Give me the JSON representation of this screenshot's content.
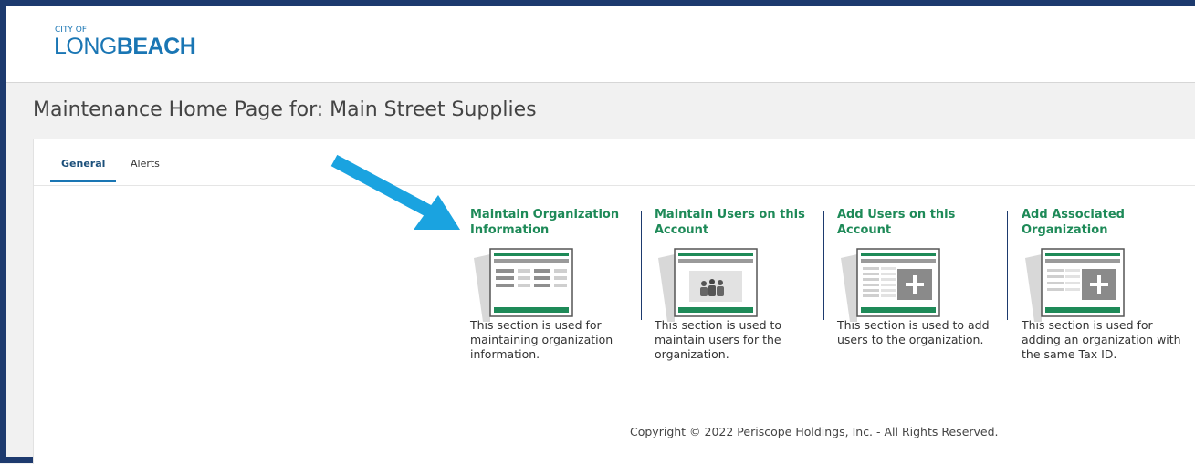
{
  "header": {
    "logo_cityof": "CITY OF",
    "logo_long": "LONG",
    "logo_beach": "BEACH"
  },
  "page": {
    "title": "Maintenance Home Page for: Main Street Supplies"
  },
  "tabs": [
    {
      "label": "General",
      "active": true
    },
    {
      "label": "Alerts",
      "active": false
    }
  ],
  "cards": [
    {
      "title": "Maintain Organization Information",
      "description": "This section is used for maintaining organization information.",
      "icon": "document-list-icon"
    },
    {
      "title": "Maintain Users on this Account",
      "description": "This section is used to maintain users for the organization.",
      "icon": "users-document-icon"
    },
    {
      "title": "Add Users on this Account",
      "description": "This section is used to add users to the organization.",
      "icon": "add-document-icon"
    },
    {
      "title": "Add Associated Organization",
      "description": "This section is used for adding an organization with the same Tax ID.",
      "icon": "add-document-icon"
    }
  ],
  "footer": {
    "copyright": "Copyright © 2022 Periscope Holdings, Inc. - All Rights Reserved."
  },
  "colors": {
    "accent_green": "#1e8a58",
    "logo_blue": "#1a76b4",
    "frame_navy": "#1d3a6e",
    "arrow_blue": "#1aa3e0"
  }
}
